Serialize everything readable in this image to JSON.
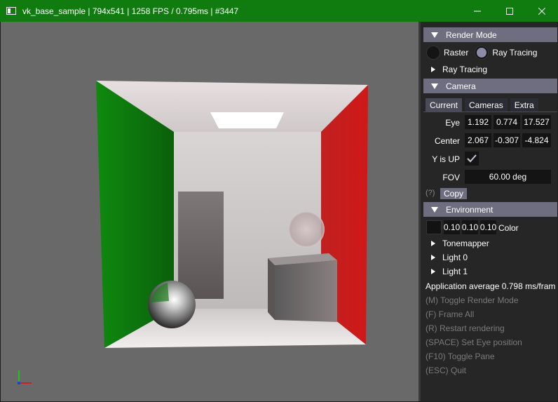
{
  "window": {
    "title": "vk_base_sample | 794x541 | 1258 FPS / 0.795ms | #3447",
    "controls": [
      "minimize",
      "maximize",
      "close"
    ]
  },
  "viewport": {
    "description_icon": "axis-gizmo-icon"
  },
  "panel": {
    "render_mode": {
      "header": "Render Mode",
      "options": [
        {
          "label": "Raster",
          "selected": false
        },
        {
          "label": "Ray Tracing",
          "selected": true
        }
      ],
      "tree": "Ray Tracing"
    },
    "camera": {
      "header": "Camera",
      "tabs": [
        "Current",
        "Cameras",
        "Extra"
      ],
      "active_tab": "Current",
      "eye_label": "Eye",
      "eye": [
        "1.192",
        "0.774",
        "17.527"
      ],
      "center_label": "Center",
      "center": [
        "2.067",
        "-0.307",
        "-4.824"
      ],
      "yup_label": "Y is UP",
      "yup_checked": true,
      "fov_label": "FOV",
      "fov_value": "60.00 deg",
      "help": "(?)",
      "copy_label": "Copy"
    },
    "environment": {
      "header": "Environment",
      "color_values": [
        "0.10",
        "0.10",
        "0.10"
      ],
      "color_label": "Color",
      "tree": [
        "Tonemapper",
        "Light 0",
        "Light 1"
      ]
    },
    "info": {
      "average": "Application average 0.798 ms/fram",
      "shortcuts": [
        "(M) Toggle Render Mode",
        "(F) Frame All",
        "(R) Restart rendering",
        "(SPACE) Set Eye position",
        "(F10) Toggle Pane",
        "(ESC) Quit"
      ]
    }
  }
}
